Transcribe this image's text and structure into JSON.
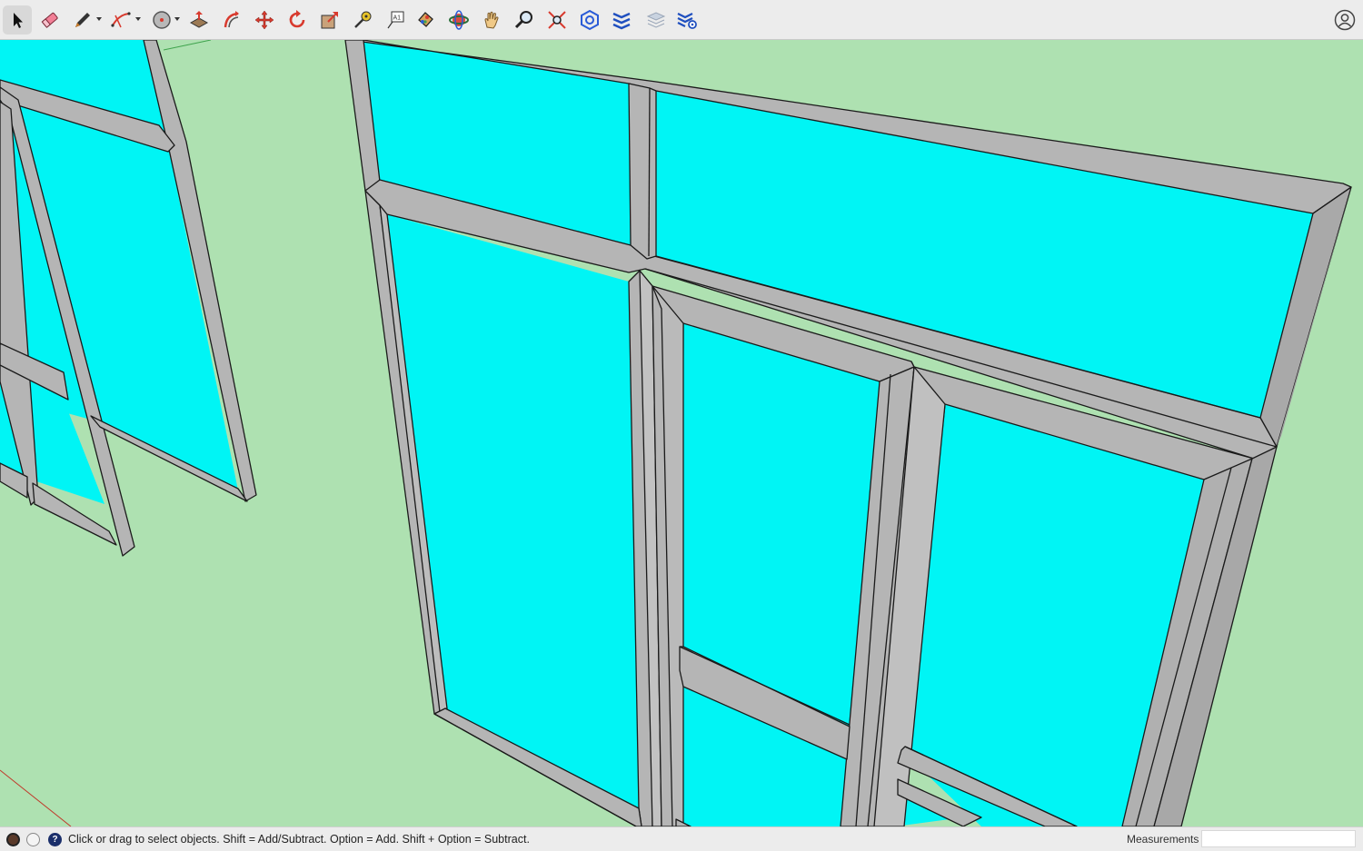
{
  "toolbar": {
    "tools": [
      {
        "name": "select-tool",
        "icon": "arrow-cursor-icon",
        "active": true
      },
      {
        "name": "eraser-tool",
        "icon": "eraser-icon"
      },
      {
        "name": "line-tool",
        "icon": "pencil-icon",
        "has_dropdown": true
      },
      {
        "name": "arc-tool",
        "icon": "arc-icon",
        "has_dropdown": true
      },
      {
        "name": "shapes-tool",
        "icon": "circle-shape-icon",
        "has_dropdown": true
      },
      {
        "name": "push-pull-tool",
        "icon": "push-pull-icon"
      },
      {
        "name": "offset-tool",
        "icon": "offset-icon"
      },
      {
        "name": "move-tool",
        "icon": "move-arrows-icon"
      },
      {
        "name": "rotate-tool",
        "icon": "rotate-icon"
      },
      {
        "name": "scale-tool",
        "icon": "scale-icon"
      },
      {
        "name": "tape-measure-tool",
        "icon": "tape-measure-icon"
      },
      {
        "name": "text-tool",
        "icon": "text-label-icon",
        "glyph": "A1"
      },
      {
        "name": "paint-bucket-tool",
        "icon": "paint-bucket-icon"
      },
      {
        "name": "orbit-tool",
        "icon": "orbit-icon"
      },
      {
        "name": "pan-tool",
        "icon": "hand-icon"
      },
      {
        "name": "zoom-tool",
        "icon": "magnifier-icon"
      },
      {
        "name": "zoom-extents-tool",
        "icon": "zoom-extents-icon"
      },
      {
        "name": "warehouse-tool",
        "icon": "3d-warehouse-icon"
      },
      {
        "name": "extension-warehouse-tool",
        "icon": "extension-warehouse-icon"
      },
      {
        "name": "layout-tool",
        "icon": "layers-icon"
      },
      {
        "name": "extension-manager-tool",
        "icon": "extension-manager-icon"
      }
    ],
    "account_icon": "account-icon"
  },
  "status": {
    "message": "Click or drag to select objects. Shift = Add/Subtract. Option = Add. Shift + Option = Subtract.",
    "measurements_label": "Measurements",
    "measurements_value": ""
  },
  "colors": {
    "ground": "#aee1b1",
    "glass": "#00f5f5",
    "frame": "#b5b5b5",
    "frame_edge": "#1a1a1a",
    "accent_red": "#d83a2e",
    "accent_blue": "#2a5bd7"
  }
}
